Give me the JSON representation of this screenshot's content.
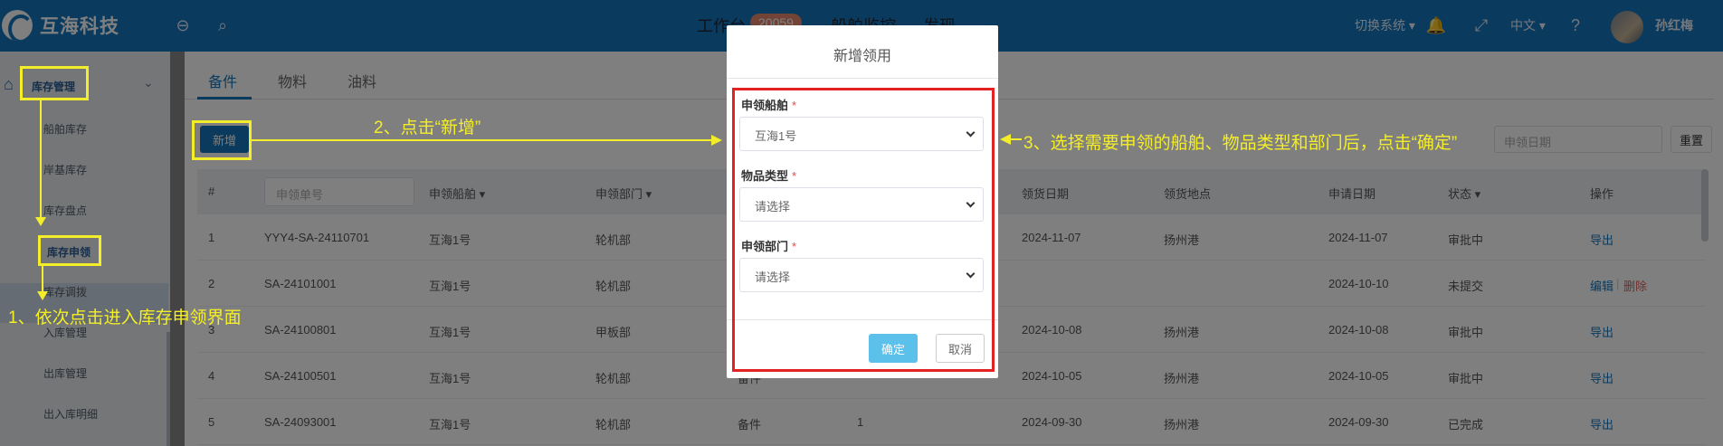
{
  "app": {
    "title": "互海科技"
  },
  "header": {
    "nav": [
      "工作台",
      "船舶监控",
      "发现"
    ],
    "workbench_badge": "20059",
    "switch_system": "切换系统",
    "language": "中文",
    "user_name": "孙红梅"
  },
  "sidebar": {
    "group": "库存管理",
    "items": [
      "船舶库存",
      "岸基库存",
      "库存盘点",
      "库存申领",
      "库存调拨",
      "入库管理",
      "出库管理",
      "出入库明细"
    ]
  },
  "tabs": [
    "备件",
    "物料",
    "油料"
  ],
  "toolbar": {
    "new_label": "新增",
    "date_placeholder": "申领日期",
    "reset_label": "重置"
  },
  "table": {
    "headers": {
      "index": "#",
      "order_no_placeholder": "申领单号",
      "ship": "申领船舶",
      "dept": "申领部门",
      "receive_date": "领货日期",
      "receive_place": "领货地点",
      "apply_date": "申请日期",
      "status": "状态",
      "ops": "操作"
    },
    "rows": [
      {
        "idx": "1",
        "no": "YYY4-SA-24110701",
        "ship": "互海1号",
        "dept": "轮机部",
        "type": "",
        "qty": "",
        "recv_date": "2024-11-07",
        "place": "扬州港",
        "apply": "2024-11-07",
        "status": "审批中",
        "op1": "导出",
        "op2": ""
      },
      {
        "idx": "2",
        "no": "SA-24101001",
        "ship": "互海1号",
        "dept": "轮机部",
        "type": "",
        "qty": "",
        "recv_date": "",
        "place": "",
        "apply": "2024-10-10",
        "status": "未提交",
        "op1": "编辑",
        "op2": "删除"
      },
      {
        "idx": "3",
        "no": "SA-24100801",
        "ship": "互海1号",
        "dept": "甲板部",
        "type": "",
        "qty": "",
        "recv_date": "2024-10-08",
        "place": "扬州港",
        "apply": "2024-10-08",
        "status": "审批中",
        "op1": "导出",
        "op2": ""
      },
      {
        "idx": "4",
        "no": "SA-24100501",
        "ship": "互海1号",
        "dept": "轮机部",
        "type": "备件",
        "qty": "",
        "recv_date": "2024-10-05",
        "place": "扬州港",
        "apply": "2024-10-05",
        "status": "审批中",
        "op1": "导出",
        "op2": ""
      },
      {
        "idx": "5",
        "no": "SA-24093001",
        "ship": "互海1号",
        "dept": "轮机部",
        "type": "备件",
        "qty": "1",
        "recv_date": "2024-09-30",
        "place": "扬州港",
        "apply": "2024-09-30",
        "status": "已完成",
        "op1": "导出",
        "op2": ""
      }
    ]
  },
  "modal": {
    "title": "新增领用",
    "ship_label": "申领船舶",
    "ship_value": "互海1号",
    "type_label": "物品类型",
    "type_placeholder": "请选择",
    "dept_label": "申领部门",
    "dept_placeholder": "请选择",
    "ok_label": "确定",
    "cancel_label": "取消",
    "required_mark": "*"
  },
  "annotations": {
    "step1": "1、依次点击进入库存申领界面",
    "step2": "2、点击“新增”",
    "step3": "3、选择需要申领的船舶、物品类型和部门后，点击“确定”"
  },
  "colors": {
    "brand": "#1577bf",
    "annotation": "#f4ee2a",
    "highlight_red": "#e32222",
    "confirm": "#5bc0ea"
  }
}
